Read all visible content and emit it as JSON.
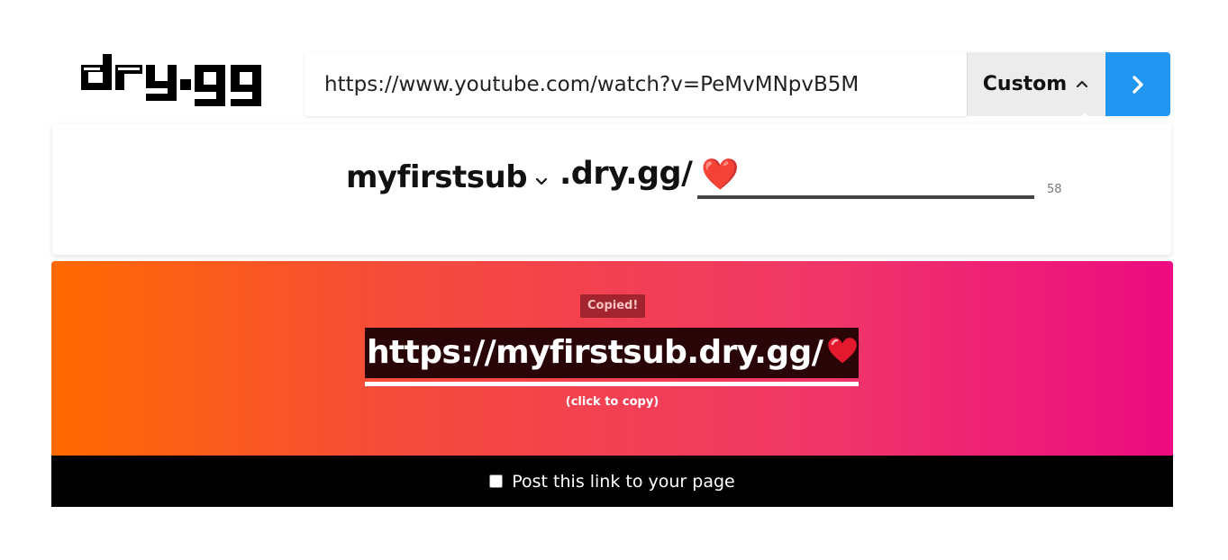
{
  "logo": {
    "text": "dry.gg"
  },
  "url_bar": {
    "value": "https://www.youtube.com/watch?v=PeMvMNpvB5M",
    "custom_label": "Custom",
    "go_icon": "chevron-right-icon"
  },
  "custom_panel": {
    "subdomain": "myfirstsub",
    "domain_suffix": ".dry.gg/",
    "path_value": "❤️",
    "char_count": "58"
  },
  "result": {
    "copied_label": "Copied!",
    "short_link": "https://myfirstsub.dry.gg/",
    "copy_hint": "(click to copy)"
  },
  "post_bar": {
    "label": "Post this link to your page",
    "checked": false
  },
  "colors": {
    "go_button": "#2196f3",
    "gradient_start": "#ff6a00",
    "gradient_end": "#ec0b80",
    "copied_badge": "#a1242f"
  }
}
